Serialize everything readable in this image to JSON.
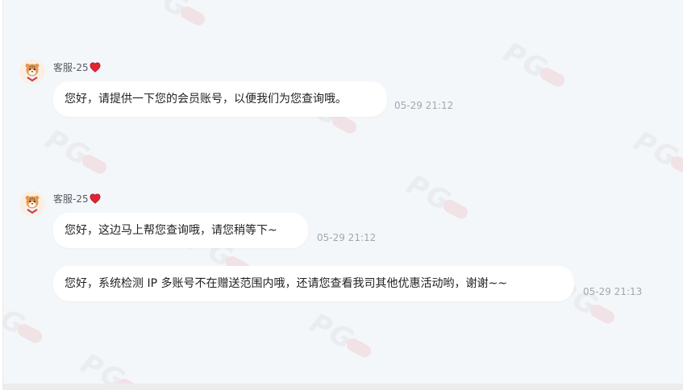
{
  "chat": {
    "groups": [
      {
        "sender": "客服-25",
        "messages": [
          {
            "text": "您好，请提供一下您的会员账号，以便我们为您查询哦。",
            "time": "05-29 21:12"
          }
        ]
      },
      {
        "sender": "客服-25",
        "messages": [
          {
            "text": "您好，这边马上帮您查询哦，请您稍等下~",
            "time": "05-29 21:12"
          },
          {
            "text": "您好，系统检测 IP 多账号不在赠送范围内哦，还请您查看我司其他优惠活动哟，谢谢~~",
            "time": "05-29 21:13"
          }
        ]
      }
    ],
    "watermark_text": "PG"
  },
  "colors": {
    "background": "#f4f7fa",
    "bubble": "#ffffff",
    "heart": "#e02433",
    "timestamp": "#a3a7ab"
  },
  "icons": {
    "avatar": "tiger-avatar-icon",
    "heart": "heart-icon"
  }
}
